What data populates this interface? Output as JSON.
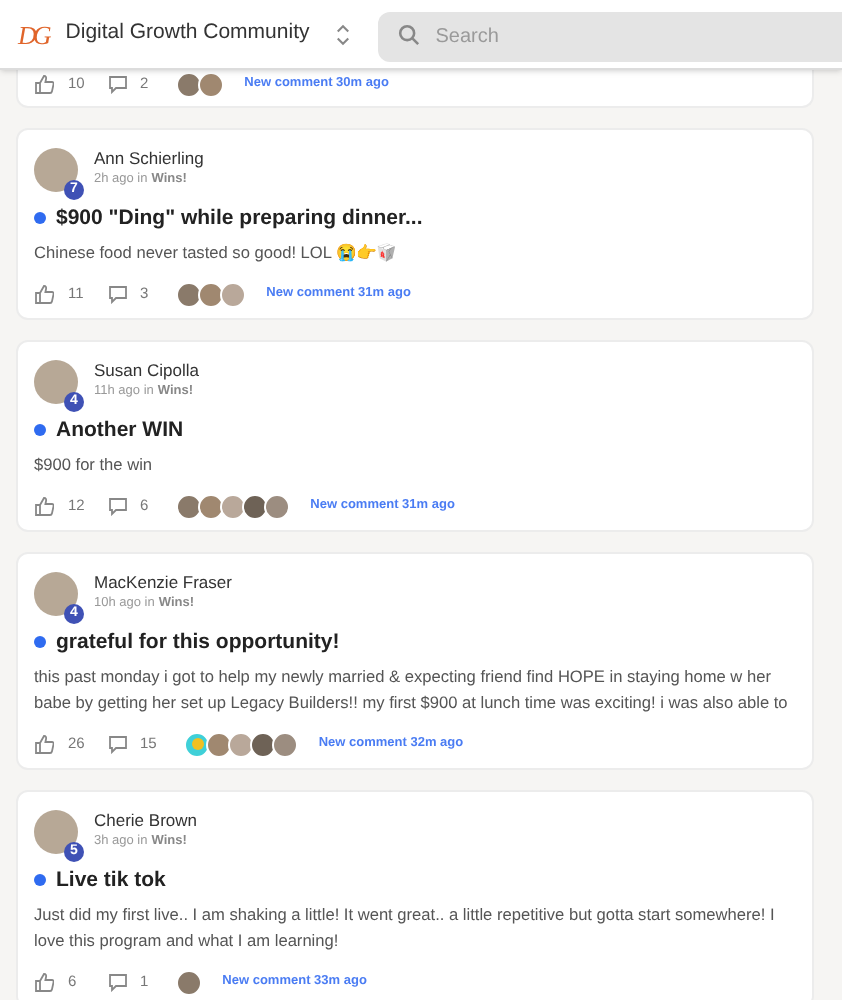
{
  "header": {
    "logo": "DG",
    "community": "Digital Growth Community",
    "search": {
      "placeholder": "Search"
    }
  },
  "posts": [
    {
      "likes": "10",
      "comments": "2",
      "commenters": [
        {
          "kind": "photo"
        },
        {
          "kind": "photo"
        }
      ],
      "new_comment": "New comment 30m ago"
    },
    {
      "author": "Ann Schierling",
      "level_badge": "7",
      "time": "2h ago in",
      "category": "Wins!",
      "unread": true,
      "title": "$900 \"Ding\" while preparing dinner...",
      "body": "Chinese food never tasted so good! LOL 😭👉🥡",
      "likes": "11",
      "comments": "3",
      "commenters": [
        {
          "kind": "photo"
        },
        {
          "kind": "photo"
        },
        {
          "kind": "photo"
        }
      ],
      "new_comment": "New comment 31m ago"
    },
    {
      "author": "Susan Cipolla",
      "level_badge": "4",
      "time": "11h ago in",
      "category": "Wins!",
      "unread": true,
      "title": "Another WIN",
      "body": "$900 for the win",
      "likes": "12",
      "comments": "6",
      "commenters": [
        {
          "kind": "photo"
        },
        {
          "kind": "photo"
        },
        {
          "kind": "photo"
        },
        {
          "kind": "photo"
        },
        {
          "kind": "photo"
        }
      ],
      "new_comment": "New comment 31m ago"
    },
    {
      "author": "MacKenzie Fraser",
      "level_badge": "4",
      "time": "10h ago in",
      "category": "Wins!",
      "unread": true,
      "title": "grateful for this opportunity!",
      "body": "this past monday i got to help my newly married & expecting friend find HOPE in staying home w her babe by getting her set up Legacy Builders!! my first $900 at lunch time was exciting! i was also able to",
      "likes": "26",
      "comments": "15",
      "commenters": [
        {
          "kind": "icon"
        },
        {
          "kind": "photo"
        },
        {
          "kind": "photo"
        },
        {
          "kind": "photo"
        },
        {
          "kind": "photo"
        }
      ],
      "new_comment": "New comment 32m ago"
    },
    {
      "author": "Cherie Brown",
      "level_badge": "5",
      "time": "3h ago in",
      "category": "Wins!",
      "unread": true,
      "title": "Live tik tok",
      "body": "Just did my first live.. I am shaking a little! It went great.. a little repetitive but gotta start somewhere! I love this program and what I am learning!",
      "likes": "6",
      "comments": "1",
      "commenters": [
        {
          "kind": "photo"
        }
      ],
      "new_comment": "New comment 33m ago"
    }
  ]
}
